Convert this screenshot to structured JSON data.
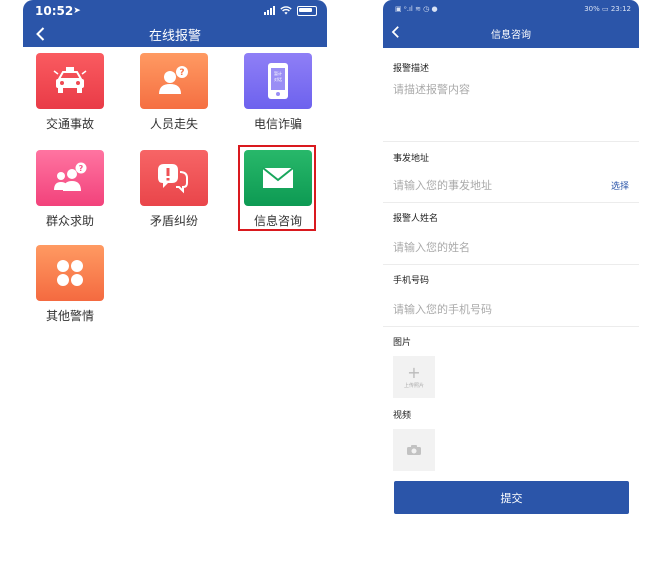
{
  "left": {
    "status": {
      "time": "10:52"
    },
    "nav": {
      "title": "在线报警"
    },
    "tiles": [
      {
        "label": "交通事故",
        "icon": "police-car-icon",
        "color": "#f04a52"
      },
      {
        "label": "人员走失",
        "icon": "missing-person-icon",
        "color": "#f7794d"
      },
      {
        "label": "电信诈骗",
        "icon": "phone-scam-icon",
        "color": "#7b6df1",
        "icon_text": [
          "暂计",
          "对话"
        ]
      },
      {
        "label": "群众求助",
        "icon": "help-people-icon",
        "color": "#f75a8c"
      },
      {
        "label": "矛盾纠纷",
        "icon": "dispute-icon",
        "color": "#ef5255"
      },
      {
        "label": "信息咨询",
        "icon": "mail-icon",
        "color": "#18a65c"
      },
      {
        "label": "其他警情",
        "icon": "clover-icon",
        "color": "#f7794d"
      }
    ]
  },
  "right": {
    "status": {
      "left": "▣ ᵒ.ıl ≋ ◷ ●",
      "right": "30% ▭ 23:12"
    },
    "nav": {
      "title": "信息咨询"
    },
    "form": {
      "desc_label": "报警描述",
      "desc_placeholder": "请描述报警内容",
      "address_label": "事发地址",
      "address_placeholder": "请输入您的事发地址",
      "address_action": "选择",
      "name_label": "报警人姓名",
      "name_placeholder": "请输入您的姓名",
      "phone_label": "手机号码",
      "phone_placeholder": "请输入您的手机号码",
      "photo_label": "图片",
      "photo_upload": "上传照片",
      "video_label": "视频",
      "submit": "提交"
    }
  }
}
